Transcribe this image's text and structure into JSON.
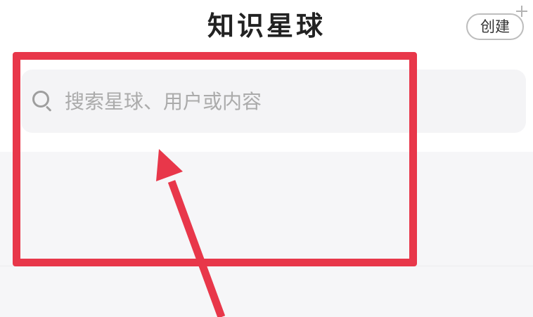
{
  "header": {
    "title": "知识星球",
    "create_label": "创建",
    "create_icon": "plus-icon"
  },
  "search": {
    "placeholder": "搜索星球、用户或内容",
    "icon": "search-icon"
  },
  "annotation": {
    "color": "#e8374a"
  }
}
